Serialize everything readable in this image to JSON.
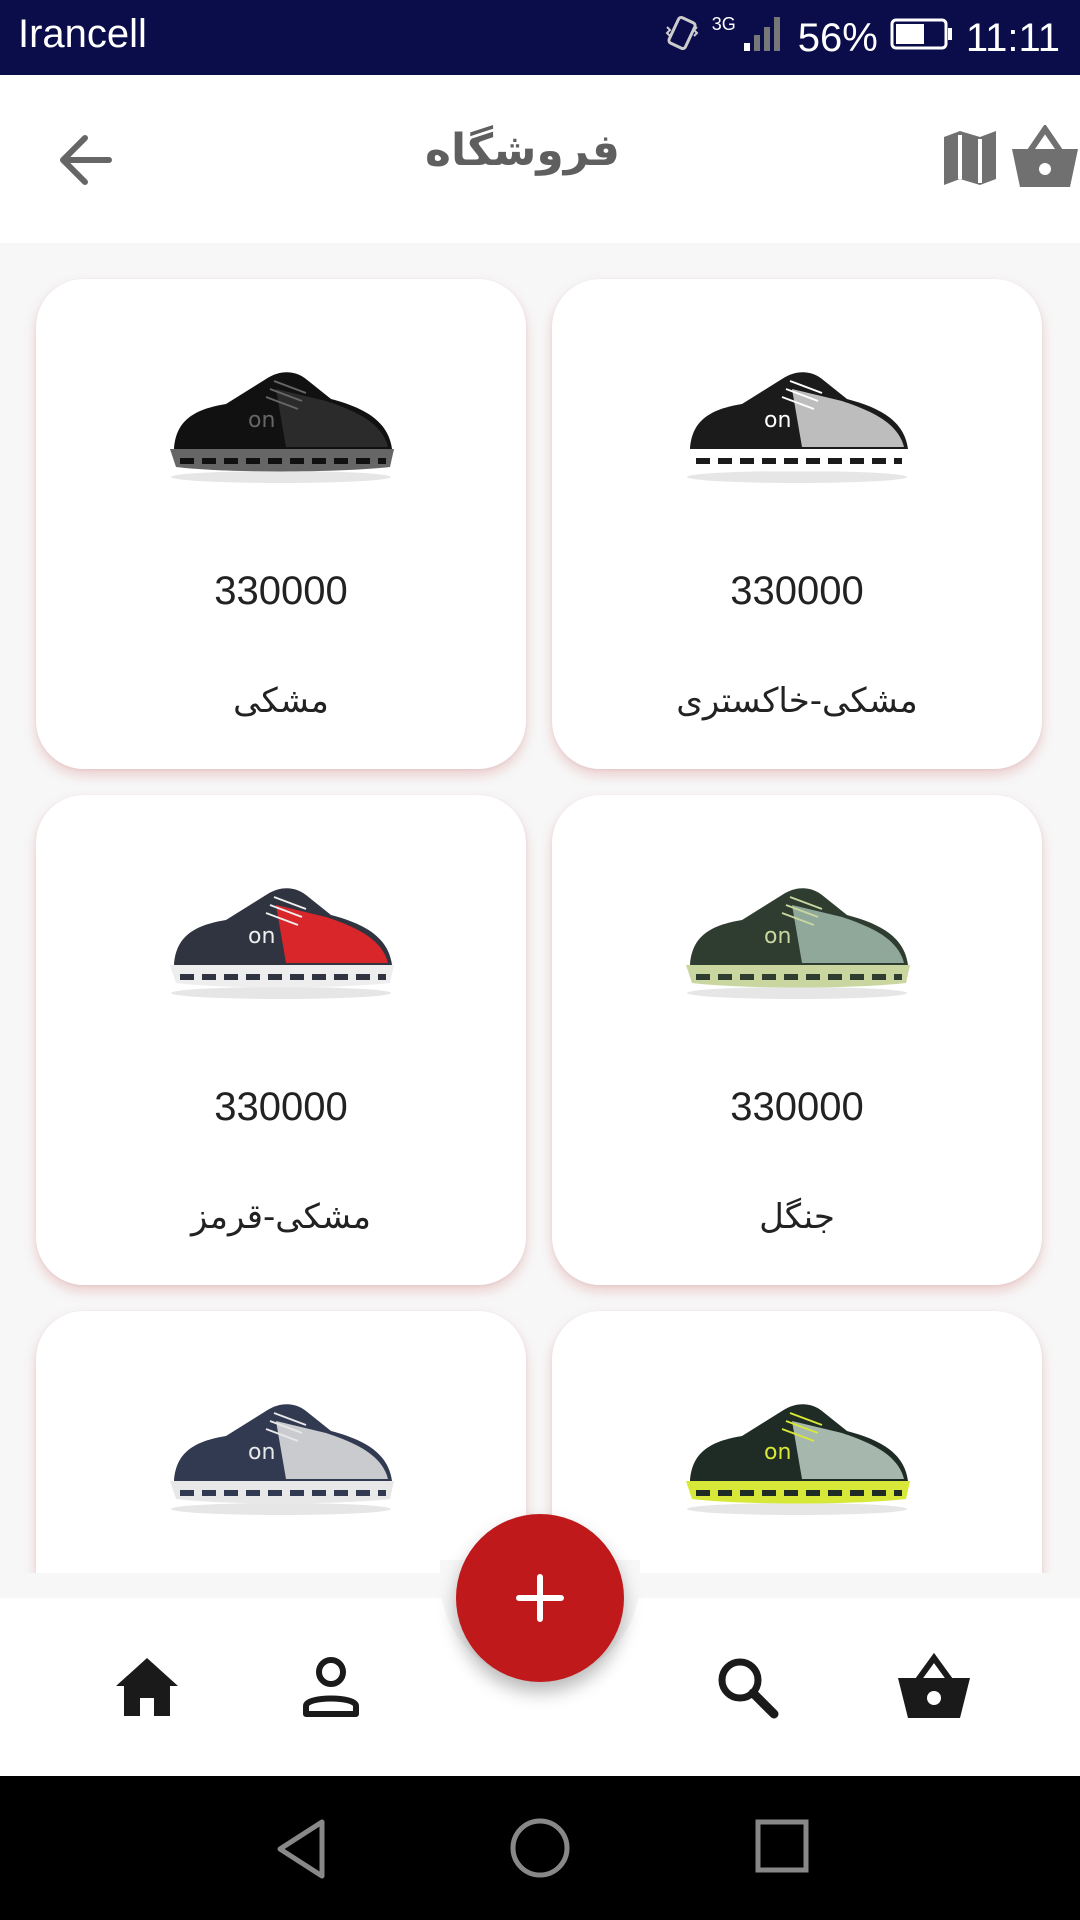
{
  "status_bar": {
    "carrier": "Irancell",
    "network": "3G",
    "battery": "56%",
    "time": "11:11",
    "icons": [
      "vibrate-icon",
      "signal-icon",
      "battery-icon"
    ]
  },
  "app_bar": {
    "title": "فروشگاه",
    "icons": [
      "back-arrow-icon",
      "map-icon",
      "basket-icon"
    ]
  },
  "products": [
    {
      "price": "330000",
      "name": "مشکی",
      "shoe_colors": [
        "#111111",
        "#2b2b2b",
        "#666666"
      ]
    },
    {
      "price": "330000",
      "name": "مشکی-خاکستری",
      "shoe_colors": [
        "#1b1b1b",
        "#bdbdbd",
        "#ffffff"
      ]
    },
    {
      "price": "330000",
      "name": "مشکی-قرمز",
      "shoe_colors": [
        "#2f3440",
        "#d8262a",
        "#eeeeee"
      ]
    },
    {
      "price": "330000",
      "name": "جنگل",
      "shoe_colors": [
        "#2f3d30",
        "#8fa89a",
        "#c9d6a0"
      ]
    },
    {
      "price": "",
      "name": "",
      "shoe_colors": [
        "#323a52",
        "#c9cbcf",
        "#e8e8e8"
      ]
    },
    {
      "price": "",
      "name": "",
      "shoe_colors": [
        "#1f2b25",
        "#a6b7ae",
        "#d8e838"
      ]
    }
  ],
  "bottom_nav": {
    "items": [
      "home-icon",
      "profile-icon",
      "search-icon",
      "basket-icon"
    ],
    "fab": "add-icon",
    "accent": "#c0191b"
  },
  "system_nav": [
    "back-icon",
    "home-circle-icon",
    "recents-icon"
  ]
}
